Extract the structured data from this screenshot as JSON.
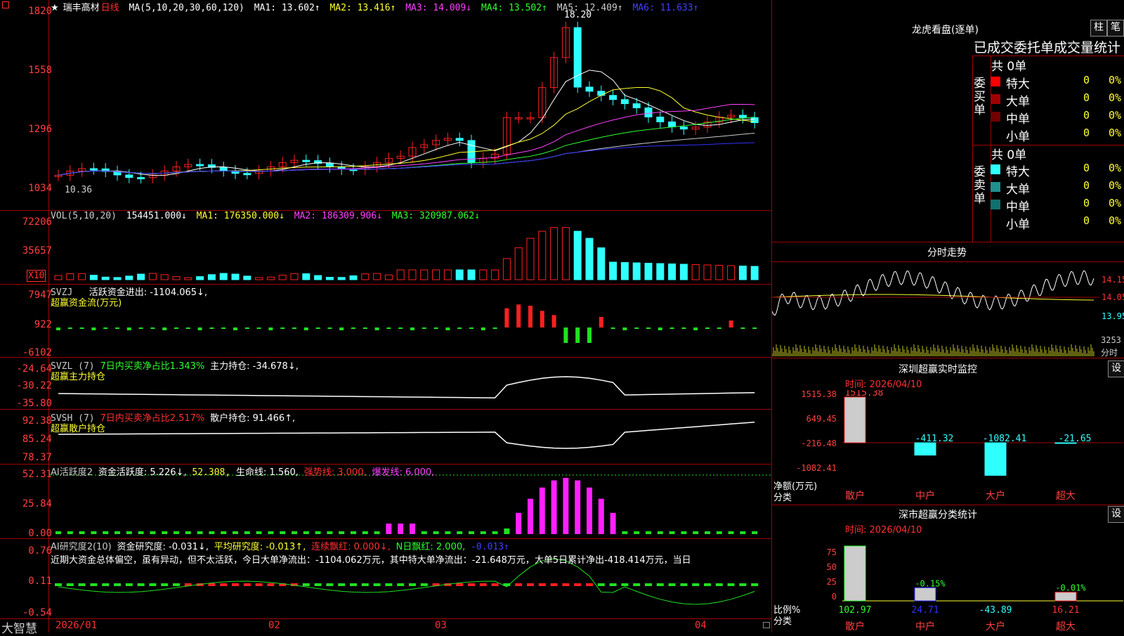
{
  "colors": {
    "up": "#ff2020",
    "down": "#30ffff",
    "grid": "#a00000",
    "ma1": "#ffffff",
    "ma2": "#ffff30",
    "ma3": "#ff40ff",
    "ma4": "#30ff30",
    "ma5": "#cccccc",
    "ma6": "#3030ff"
  },
  "main": {
    "star": "★",
    "stock_name": "瑞丰高材",
    "period": "日线",
    "ma_label": "MA(5,10,20,30,60,120)",
    "ma": [
      "MA1: 13.602↑",
      "MA2: 13.416↑",
      "MA3: 14.009↓",
      "MA4: 13.502↑",
      "MA5: 12.409↑",
      "MA6: 11.633↑"
    ],
    "y_labels": [
      "1820",
      "1558",
      "1296",
      "1034"
    ],
    "high_mark": "18.20",
    "low_mark": "10.36"
  },
  "vol": {
    "label": "VOL(5,10,20)",
    "value": "154451.000↓",
    "ma": [
      "MA1: 176350.000↓",
      "MA2: 186309.906↓",
      "MA3: 320987.062↓"
    ],
    "y_labels": [
      "72206",
      "35657"
    ],
    "unit": "X10"
  },
  "svzj": {
    "label": "SVZJ",
    "title": "活跃资金进出: -1104.065↓,",
    "subtitle": "超赢资金流(万元)",
    "y_labels": [
      "7947",
      "922",
      "-6102"
    ]
  },
  "svzl": {
    "label": "SVZL (7)",
    "ratio": "7日内买卖净占比1.343%",
    "title": "主力持仓: -34.678↓,",
    "subtitle": "超赢主力持仓",
    "y_labels": [
      "-24.64",
      "-30.22",
      "-35.80"
    ]
  },
  "svsh": {
    "label": "SVSH (7)",
    "ratio": "7日内买卖净占比2.517%",
    "title": "散户持仓: 91.466↑,",
    "subtitle": "超赢散户持仓",
    "y_labels": [
      "92.38",
      "85.24",
      "78.37"
    ]
  },
  "ai1": {
    "label": "AI活跃度2",
    "title": "资金活跃度: 5.226↓,",
    "v2": "52.308,",
    "v3": "生命线: 1.560,",
    "v4": "强势线: 3.000,",
    "v5": "爆发线: 6.000,",
    "y_labels": [
      "52.31",
      "25.84",
      "0.00"
    ]
  },
  "ai2": {
    "label": "AI研究度2(10)",
    "title": "资金研究度: -0.031↓,",
    "v2": "平均研究度: -0.013↑,",
    "v3": "连续飘红: 0.000↓,",
    "v4": "N日飘红: 2.000,",
    "v5": "-0.013↑",
    "text": "近期大资金总体偏空，虽有异动，但不太活跃，今日大单净流出：-1104.062万元，其中特大单净流出：-21.648万元，大单5日累计净出-418.414万元，当日",
    "y_labels": [
      "0.76",
      "0.11",
      "-0.54"
    ]
  },
  "xaxis": {
    "labels": [
      "2026/01",
      "02",
      "03",
      "04"
    ],
    "brand": "大智慧"
  },
  "right": {
    "lhb_title": "龙虎看盘(逐单)",
    "btn1": "柱",
    "btn2": "笔",
    "tabs_header": "已成交委托单成交量统计",
    "buy_total": "共 0单",
    "sell_total": "共 0单",
    "buy_label": "委买单",
    "sell_label": "委卖单",
    "buy_rows": [
      {
        "name": "特大",
        "count": "0",
        "pct": "0%",
        "color": "#ff0000"
      },
      {
        "name": "大单",
        "count": "0",
        "pct": "0%",
        "color": "#a00000"
      },
      {
        "name": "中单",
        "count": "0",
        "pct": "0%",
        "color": "#700000"
      },
      {
        "name": "小单",
        "count": "0",
        "pct": "0%",
        "color": ""
      }
    ],
    "sell_rows": [
      {
        "name": "特大",
        "count": "0",
        "pct": "0%",
        "color": "#30ffff"
      },
      {
        "name": "大单",
        "count": "0",
        "pct": "0%",
        "color": "#209090"
      },
      {
        "name": "中单",
        "count": "0",
        "pct": "0%",
        "color": "#107070"
      },
      {
        "name": "小单",
        "count": "0",
        "pct": "0%",
        "color": ""
      }
    ],
    "minute_title": "分时走势",
    "minute_y": [
      "14.15",
      "14.05",
      "13.95"
    ],
    "minute_vol": "3253",
    "minute_vol_unit": "分时",
    "monitor_title": "深圳超赢实时监控",
    "monitor_set": "设",
    "monitor_time": "时间: 2026/04/10",
    "monitor_y": [
      "1515.38",
      "649.45",
      "-216.48",
      "-1082.41"
    ],
    "monitor_unit": "净额(万元)",
    "monitor_cat": "分类",
    "monitor_bars": [
      {
        "name": "散户",
        "value": "1515.38",
        "v": 1515.38
      },
      {
        "name": "中户",
        "value": "-411.32",
        "v": -411.32
      },
      {
        "name": "大户",
        "value": "-1082.41",
        "v": -1082.41
      },
      {
        "name": "超大",
        "value": "-21.65",
        "v": -21.65
      }
    ],
    "stats_title": "深市超赢分类统计",
    "stats_set": "设",
    "stats_time": "时间: 2026/04/10",
    "stats_y": [
      "75",
      "50",
      "25",
      "0"
    ],
    "stats_unit": "比例%",
    "stats_cat": "分类",
    "stats_bars": [
      {
        "name": "散户",
        "value": "102.97",
        "v": 102.97,
        "pct": ""
      },
      {
        "name": "中户",
        "value": "24.71",
        "v": 24.71,
        "pct": "-0.15%"
      },
      {
        "name": "大户",
        "value": "-43.89",
        "v": -43.89,
        "pct": ""
      },
      {
        "name": "超大",
        "value": "16.21",
        "v": 16.21,
        "pct": "-0.01%"
      }
    ]
  }
}
